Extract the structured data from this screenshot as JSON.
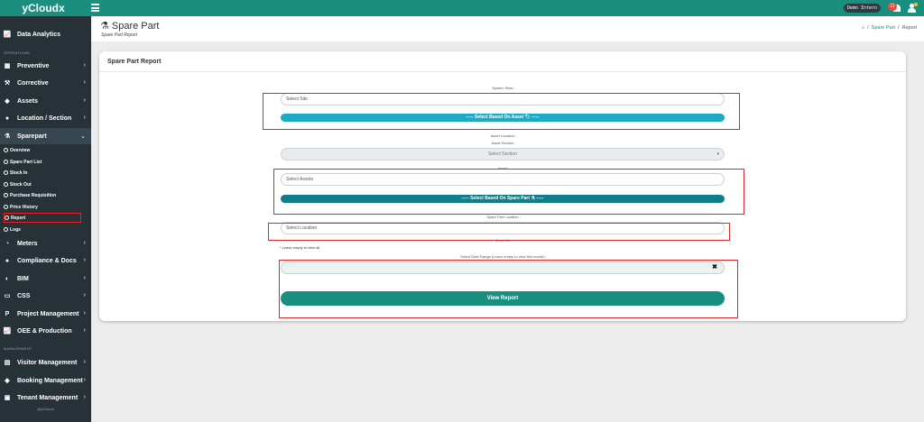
{
  "app": {
    "brand": "yCloudx"
  },
  "topbar": {
    "org": "Demo Intern",
    "notif_count": "11"
  },
  "colors": {
    "brand": "#1b8f7f",
    "sidebar": "#263238",
    "cyan_button": "#1eaac2",
    "teal_button": "#137e8a",
    "highlight": "#d82a2a"
  },
  "sidebar": {
    "top_item": {
      "label": "Data Analytics",
      "icon": "line-chart-icon"
    },
    "sections": {
      "operations": "OPERATIONS",
      "management": "MANAGEMENT"
    },
    "ops_items": [
      {
        "label": "Preventive",
        "icon": "calendar-icon"
      },
      {
        "label": "Corrective",
        "icon": "wrench-icon"
      },
      {
        "label": "Assets",
        "icon": "tag-icon"
      },
      {
        "label": "Location / Section",
        "icon": "globe-icon"
      },
      {
        "label": "Sparepart",
        "icon": "tools-icon"
      }
    ],
    "sparepart_sub": [
      "Overview",
      "Spare Part List",
      "Stock In",
      "Stock Out",
      "Purchase Requisition",
      "Price History",
      "Report",
      "Logs"
    ],
    "more_items": [
      {
        "label": "Meters",
        "icon": "gauge-icon"
      },
      {
        "label": "Compliance & Docs",
        "icon": "circle-icon"
      },
      {
        "label": "BIM",
        "icon": "cube-icon"
      },
      {
        "label": "CSS",
        "icon": "monitor-icon"
      },
      {
        "label": "Project Management",
        "icon": "p-icon"
      },
      {
        "label": "OEE & Production",
        "icon": "chart-icon"
      }
    ],
    "mgmt_items": [
      {
        "label": "Visitor Management",
        "icon": "id-card-icon"
      },
      {
        "label": "Booking Management",
        "icon": "diamond-icon"
      },
      {
        "label": "Tenant Management",
        "icon": "building-icon"
      }
    ],
    "footer": "@yCloudx"
  },
  "page": {
    "title": "Spare Part",
    "subtitle": "Spare Part Report",
    "breadcrumb": {
      "level1": "Spare Part",
      "level2": "Report"
    }
  },
  "form": {
    "card_title": "Spare Part Report",
    "system_sites_label": "System Sites :",
    "site_placeholder": "Select Site",
    "based_on_asset_btn": "----- Select Based On Asset 🏷 -----",
    "asset_location_label": "Asset Location :",
    "asset_section_label": "Asset Section :",
    "section_placeholder": "Select Section",
    "asset_label": "Asset :",
    "assets_placeholder": "Select Assets",
    "based_on_sparepart_btn": "----- Select Based On Spare Part ⚗ -----",
    "sparepart_location_label": "Spare Part Location :",
    "location_placeholder": "Select Location",
    "stock_no_label": "Stock No :",
    "leave_empty_note": "* Leave empty to view all",
    "date_range_label": "Select Date Range (Leave empty to view this month) :",
    "date_value": "",
    "clear_symbol": "✖",
    "view_report_btn": "View Report"
  }
}
